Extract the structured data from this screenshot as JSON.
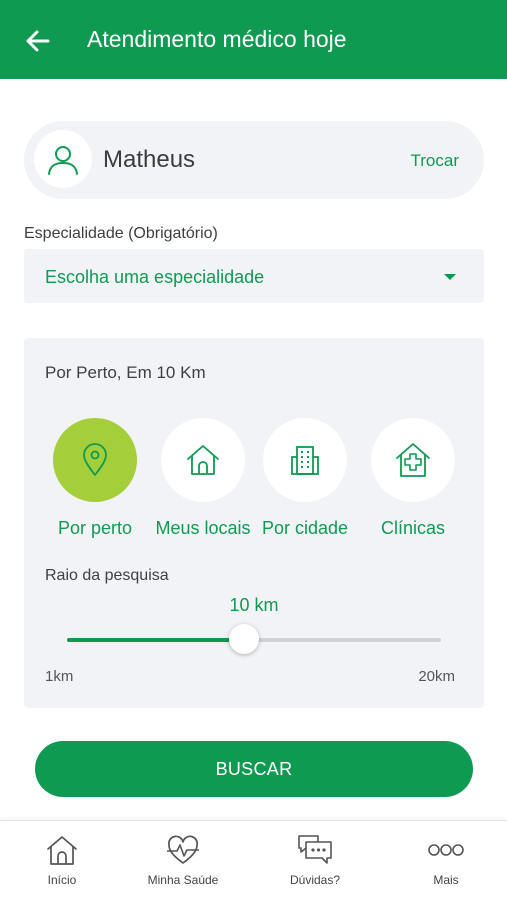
{
  "header": {
    "title": "Atendimento médico hoje",
    "back_icon": "arrow-left-icon",
    "background": "#0f9a52"
  },
  "user": {
    "name": "Matheus",
    "swap_label": "Trocar",
    "avatar_icon": "user-icon"
  },
  "specialty": {
    "label": "Especialidade (Obrigatório)",
    "value": "Escolha uma especialidade",
    "dropdown_icon": "caret-down-icon"
  },
  "location": {
    "title": "Por Perto, Em 10 Km",
    "options": [
      {
        "label": "Por perto",
        "icon": "map-pin-icon",
        "selected": true
      },
      {
        "label": "Meus locais",
        "icon": "home-icon",
        "selected": false
      },
      {
        "label": "Por cidade",
        "icon": "building-icon",
        "selected": false
      },
      {
        "label": "Clínicas",
        "icon": "clinic-icon",
        "selected": false
      }
    ],
    "radius": {
      "label": "Raio da pesquisa",
      "value_text": "10 km",
      "value": 10,
      "min": 1,
      "max": 20,
      "min_label": "1km",
      "max_label": "20km"
    }
  },
  "search_button": "BUSCAR",
  "bottom_nav": [
    {
      "label": "Início",
      "icon": "home-nav-icon"
    },
    {
      "label": "Minha Saúde",
      "icon": "heart-pulse-icon"
    },
    {
      "label": "Dúvidas?",
      "icon": "chat-bubbles-icon"
    },
    {
      "label": "Mais",
      "icon": "more-icon"
    }
  ],
  "colors": {
    "primary": "#0f9a52",
    "accent_selected": "#a4cf3a",
    "surface": "#f2f3f7"
  }
}
